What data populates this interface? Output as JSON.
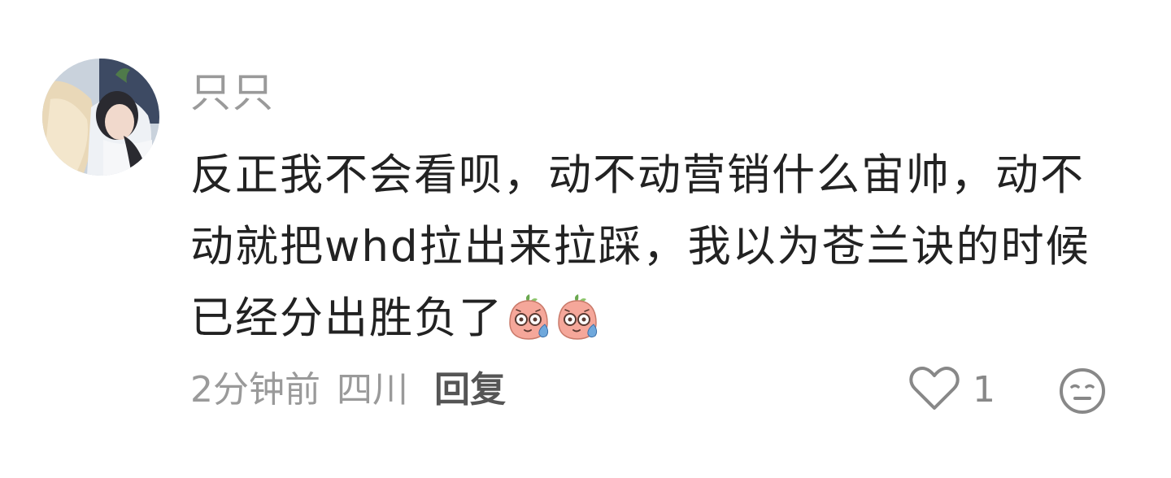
{
  "comment": {
    "username": "只只",
    "content_lines": [
      "反正我不会看呗，动不动营销什么宙帅，动不",
      "动就把whd拉出来拉踩，我以为苍兰诀的时候",
      "已经分出胜负了"
    ],
    "stickers": [
      "sweat-face-sticker-icon",
      "sweat-face-sticker-icon"
    ],
    "time": "2分钟前",
    "location": "四川",
    "reply_label": "回复",
    "like_count": "1",
    "like_icon": "heart-outline-icon",
    "dislike_icon": "meh-face-icon"
  },
  "colors": {
    "username": "#9a9a9a",
    "content": "#222222",
    "meta": "#9a9a9a",
    "reply": "#555555",
    "icon": "#888888"
  }
}
